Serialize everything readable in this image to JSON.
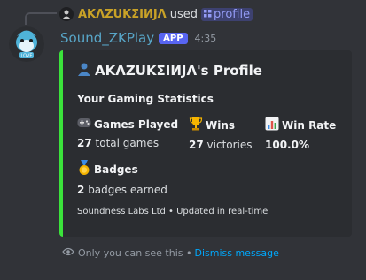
{
  "reply": {
    "avatar_icon": "user-avatar-icon",
    "name": "AKΛZUKΣIИJΛ",
    "used_text": "used",
    "command_icon": "slash-command-icon",
    "command": "profile"
  },
  "message": {
    "username": "Sound_ZKPlay",
    "app_badge": "APP",
    "timestamp": "4:35",
    "avatar_icon": "dolphin-avatar-icon"
  },
  "embed": {
    "accent_color": "#3be33b",
    "title": "AKΛZUKΣIИJΛ's Profile",
    "title_icon": "user-silhouette-icon",
    "description": "Your Gaming Statistics",
    "fields": [
      {
        "icon": "gamepad-icon",
        "name": "Games Played",
        "value_num": "27",
        "value_text": "total games"
      },
      {
        "icon": "trophy-icon",
        "name": "Wins",
        "value_num": "27",
        "value_text": "victories"
      },
      {
        "icon": "bar-chart-icon",
        "name": "Win Rate",
        "value_num": "100.0%",
        "value_text": ""
      },
      {
        "icon": "medal-icon",
        "name": "Badges",
        "value_num": "2",
        "value_text": "badges earned"
      }
    ],
    "footer": "Soundness Labs Ltd • Updated in real-time"
  },
  "ephemeral": {
    "icon": "eye-icon",
    "text": "Only you can see this •",
    "dismiss": "Dismiss message"
  }
}
